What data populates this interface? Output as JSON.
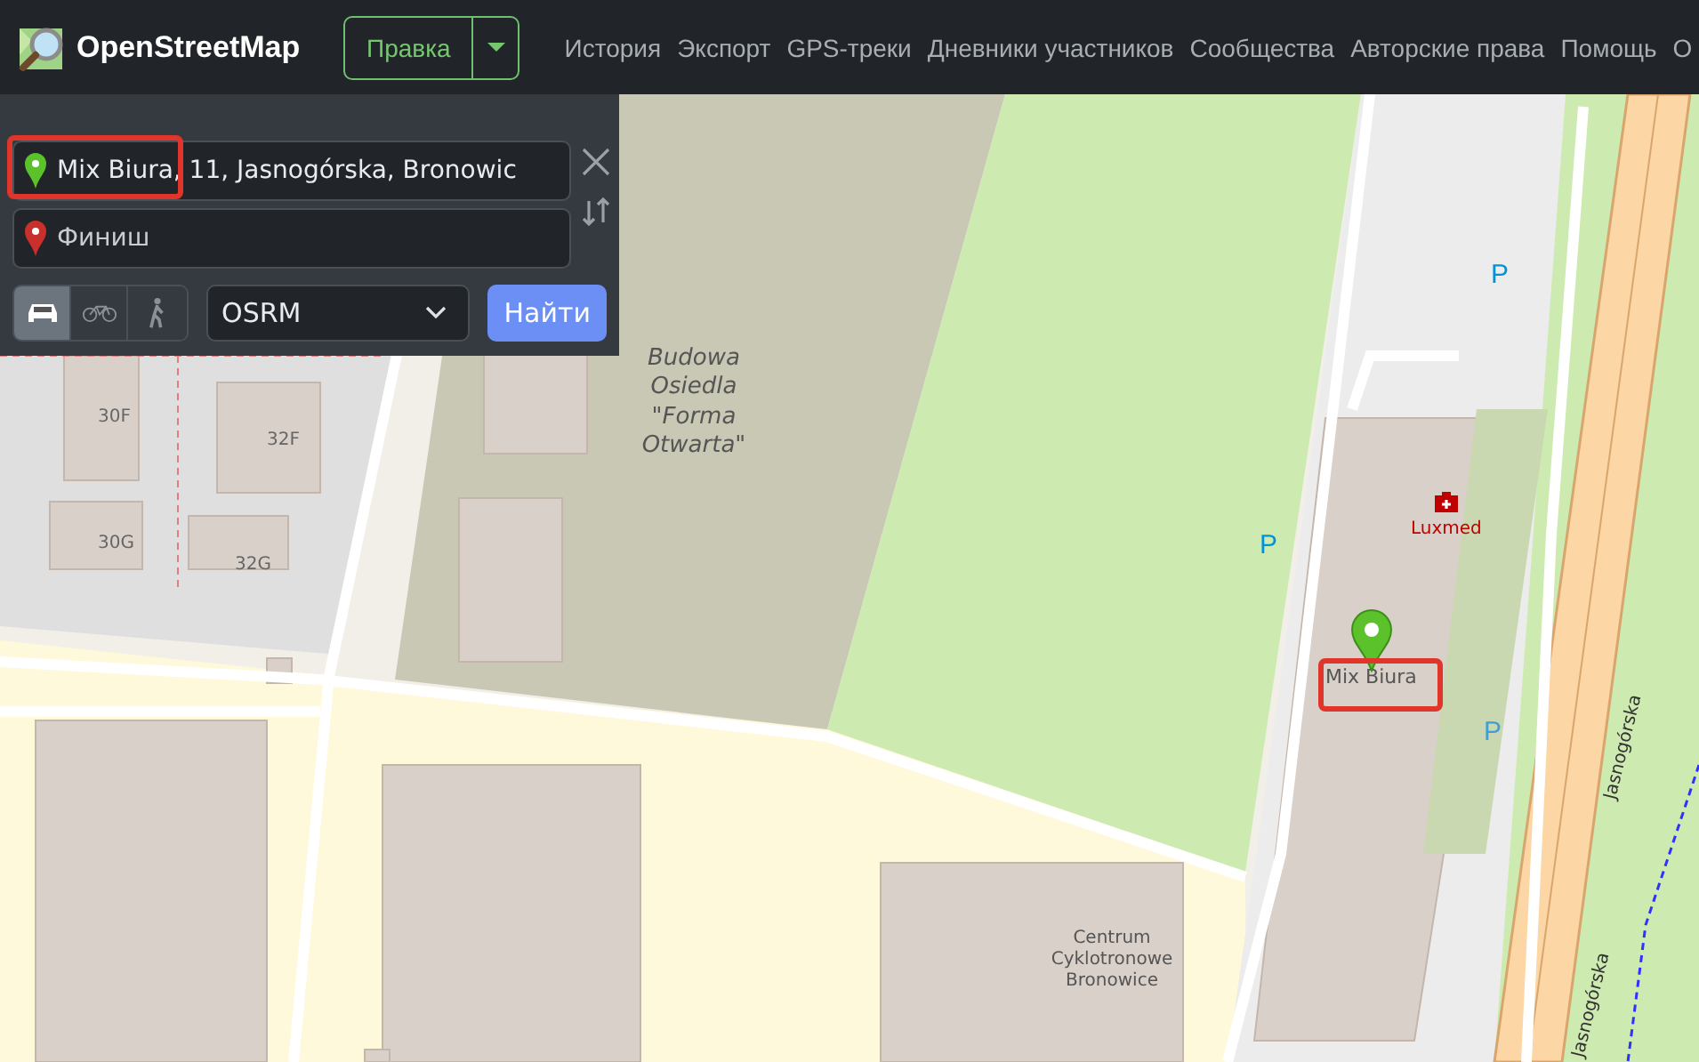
{
  "header": {
    "logo_text": "OpenStreetMap",
    "edit_button": "Правка",
    "nav_links": [
      "История",
      "Экспорт",
      "GPS-треки",
      "Дневники участников",
      "Сообщества",
      "Авторские права",
      "Помощь",
      "О"
    ]
  },
  "directions": {
    "from": {
      "value": "Mix Biura, 11, Jasnogórska, Bronowic"
    },
    "to": {
      "placeholder": "Финиш"
    },
    "modes": [
      {
        "kind": "car",
        "selected": true
      },
      {
        "kind": "bike",
        "selected": false
      },
      {
        "kind": "walk",
        "selected": false
      }
    ],
    "engine": "OSRM",
    "submit": "Найти"
  },
  "map": {
    "labels": [
      {
        "text": "Budowa Osiedla \"Forma Otwarta\"",
        "kind": "area"
      },
      {
        "text": "30F",
        "kind": "house"
      },
      {
        "text": "32F",
        "kind": "house"
      },
      {
        "text": "30G",
        "kind": "house"
      },
      {
        "text": "32G",
        "kind": "house"
      },
      {
        "text": "Centrum Cyklotronowe Bronowice",
        "kind": "building"
      },
      {
        "text": "Luxmed",
        "kind": "poi"
      },
      {
        "text": "Mix Biura",
        "kind": "marker"
      },
      {
        "text": "P",
        "kind": "parking"
      },
      {
        "text": "P",
        "kind": "parking"
      },
      {
        "text": "P",
        "kind": "parking_faint"
      },
      {
        "text": "Jasnogórska",
        "kind": "road"
      },
      {
        "text": "Jasnogórska",
        "kind": "road"
      }
    ]
  }
}
